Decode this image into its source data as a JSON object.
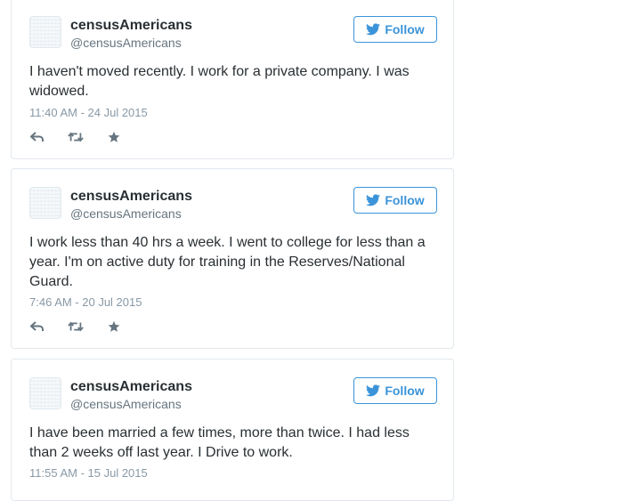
{
  "follow_label": "Follow",
  "accent_color": "#3b94d9",
  "tweets": [
    {
      "name": "censusAmericans",
      "handle": "@censusAmericans",
      "text": "I haven't moved recently. I work for a private company. I was widowed.",
      "time": "11:40 AM - 24 Jul 2015"
    },
    {
      "name": "censusAmericans",
      "handle": "@censusAmericans",
      "text": "I work less than 40 hrs a week. I went to college for less than a year. I'm on active duty for training in the Reserves/National Guard.",
      "time": "7:46 AM - 20 Jul 2015"
    },
    {
      "name": "censusAmericans",
      "handle": "@censusAmericans",
      "text": "I have been married a few times, more than twice. I had less than 2 weeks off last year. I Drive to work.",
      "time": "11:55 AM - 15 Jul 2015"
    }
  ],
  "icons": {
    "follow": "twitter-bird-icon",
    "reply": "reply-icon",
    "retweet": "retweet-icon",
    "favorite": "star-icon"
  }
}
